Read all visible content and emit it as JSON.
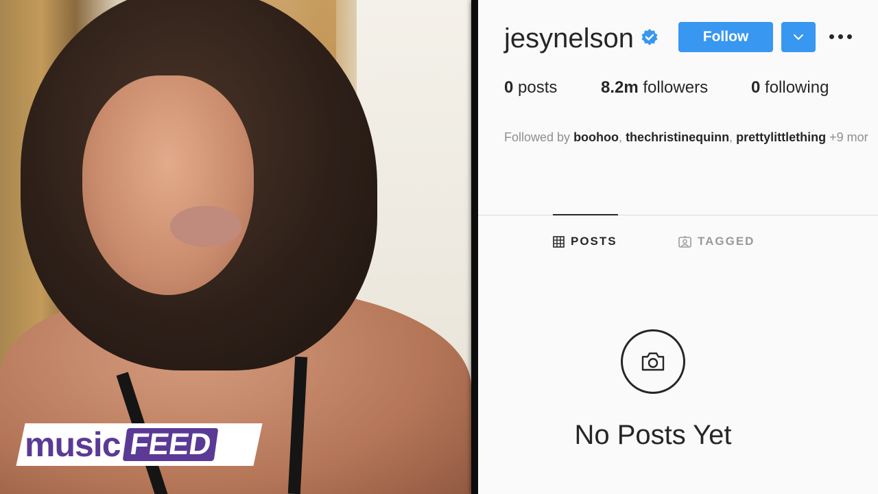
{
  "profile": {
    "username": "jesynelson",
    "follow_label": "Follow",
    "stats": {
      "posts_count": "0",
      "posts_label": "posts",
      "followers_count": "8.2m",
      "followers_label": "followers",
      "following_count": "0",
      "following_label": "following"
    },
    "followed_by": {
      "prefix": "Followed by",
      "accounts": [
        "boohoo",
        "thechristinequinn",
        "prettylittlething"
      ],
      "more": "+9 mor"
    },
    "tabs": [
      {
        "label": "POSTS",
        "active": true
      },
      {
        "label": "TAGGED",
        "active": false
      }
    ],
    "empty_state": "No Posts Yet"
  },
  "logo": {
    "word1": "music",
    "word2": "FEED"
  },
  "colors": {
    "button_blue": "#3897f0",
    "verified_blue": "#3897f0",
    "text_dark": "#262626",
    "text_muted": "#8e8e8e",
    "logo_purple": "#5b3a96"
  }
}
